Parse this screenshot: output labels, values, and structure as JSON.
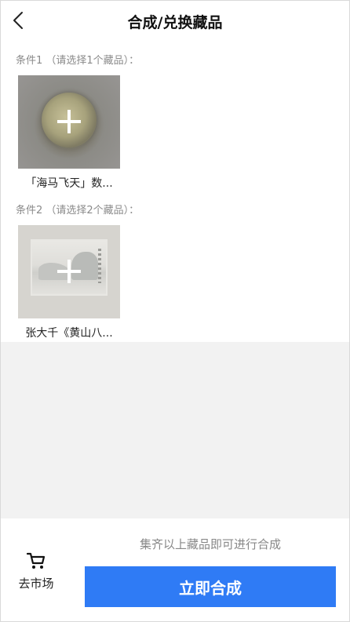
{
  "header": {
    "title": "合成/兑换藏品",
    "back_icon": "chevron-left-icon"
  },
  "conditions": [
    {
      "label": "条件1 （请选择1个藏品）：",
      "item": {
        "name": "「海马飞天」数...",
        "add_icon": "plus-icon"
      }
    },
    {
      "label": "条件2 （请选择2个藏品）：",
      "item": {
        "name": "张大千《黄山八...",
        "add_icon": "plus-icon"
      }
    }
  ],
  "footer": {
    "market_label": "去市场",
    "market_icon": "cart-icon",
    "hint": "集齐以上藏品即可进行合成",
    "submit_label": "立即合成"
  },
  "colors": {
    "accent": "#2f7bf5",
    "background": "#f2f2f2"
  }
}
